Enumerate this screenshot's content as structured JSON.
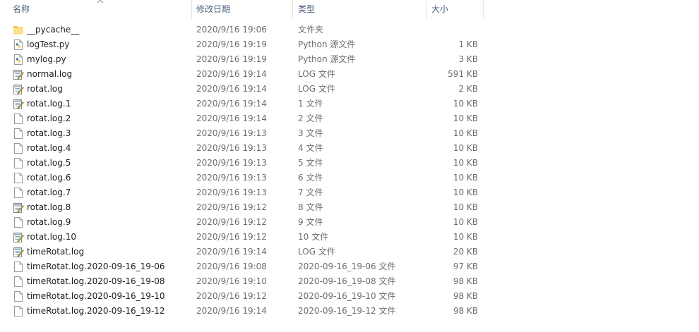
{
  "columns": {
    "name": "名称",
    "date": "修改日期",
    "type": "类型",
    "size": "大小"
  },
  "files": [
    {
      "name": "__pycache__",
      "date": "2020/9/16 19:06",
      "type": "文件夹",
      "size": "",
      "icon": "folder-icon"
    },
    {
      "name": "logTest.py",
      "date": "2020/9/16 19:19",
      "type": "Python 源文件",
      "size": "1 KB",
      "icon": "python-file-icon"
    },
    {
      "name": "mylog.py",
      "date": "2020/9/16 19:19",
      "type": "Python 源文件",
      "size": "3 KB",
      "icon": "python-file-icon"
    },
    {
      "name": "normal.log",
      "date": "2020/9/16 19:14",
      "type": "LOG 文件",
      "size": "591 KB",
      "icon": "notepad-file-icon"
    },
    {
      "name": "rotat.log",
      "date": "2020/9/16 19:14",
      "type": "LOG 文件",
      "size": "2 KB",
      "icon": "notepad-file-icon"
    },
    {
      "name": "rotat.log.1",
      "date": "2020/9/16 19:14",
      "type": "1 文件",
      "size": "10 KB",
      "icon": "notepad-file-icon"
    },
    {
      "name": "rotat.log.2",
      "date": "2020/9/16 19:14",
      "type": "2 文件",
      "size": "10 KB",
      "icon": "blank-file-icon"
    },
    {
      "name": "rotat.log.3",
      "date": "2020/9/16 19:13",
      "type": "3 文件",
      "size": "10 KB",
      "icon": "blank-file-icon"
    },
    {
      "name": "rotat.log.4",
      "date": "2020/9/16 19:13",
      "type": "4 文件",
      "size": "10 KB",
      "icon": "blank-file-icon"
    },
    {
      "name": "rotat.log.5",
      "date": "2020/9/16 19:13",
      "type": "5 文件",
      "size": "10 KB",
      "icon": "blank-file-icon"
    },
    {
      "name": "rotat.log.6",
      "date": "2020/9/16 19:13",
      "type": "6 文件",
      "size": "10 KB",
      "icon": "blank-file-icon"
    },
    {
      "name": "rotat.log.7",
      "date": "2020/9/16 19:13",
      "type": "7 文件",
      "size": "10 KB",
      "icon": "blank-file-icon"
    },
    {
      "name": "rotat.log.8",
      "date": "2020/9/16 19:12",
      "type": "8 文件",
      "size": "10 KB",
      "icon": "notepad-file-icon"
    },
    {
      "name": "rotat.log.9",
      "date": "2020/9/16 19:12",
      "type": "9 文件",
      "size": "10 KB",
      "icon": "blank-file-icon"
    },
    {
      "name": "rotat.log.10",
      "date": "2020/9/16 19:12",
      "type": "10 文件",
      "size": "10 KB",
      "icon": "notepad-file-icon"
    },
    {
      "name": "timeRotat.log",
      "date": "2020/9/16 19:14",
      "type": "LOG 文件",
      "size": "20 KB",
      "icon": "notepad-file-icon"
    },
    {
      "name": "timeRotat.log.2020-09-16_19-06",
      "date": "2020/9/16 19:08",
      "type": "2020-09-16_19-06 文件",
      "size": "97 KB",
      "icon": "blank-file-icon"
    },
    {
      "name": "timeRotat.log.2020-09-16_19-08",
      "date": "2020/9/16 19:10",
      "type": "2020-09-16_19-08 文件",
      "size": "98 KB",
      "icon": "blank-file-icon"
    },
    {
      "name": "timeRotat.log.2020-09-16_19-10",
      "date": "2020/9/16 19:12",
      "type": "2020-09-16_19-10 文件",
      "size": "98 KB",
      "icon": "blank-file-icon"
    },
    {
      "name": "timeRotat.log.2020-09-16_19-12",
      "date": "2020/9/16 19:14",
      "type": "2020-09-16_19-12 文件",
      "size": "98 KB",
      "icon": "blank-file-icon"
    }
  ]
}
